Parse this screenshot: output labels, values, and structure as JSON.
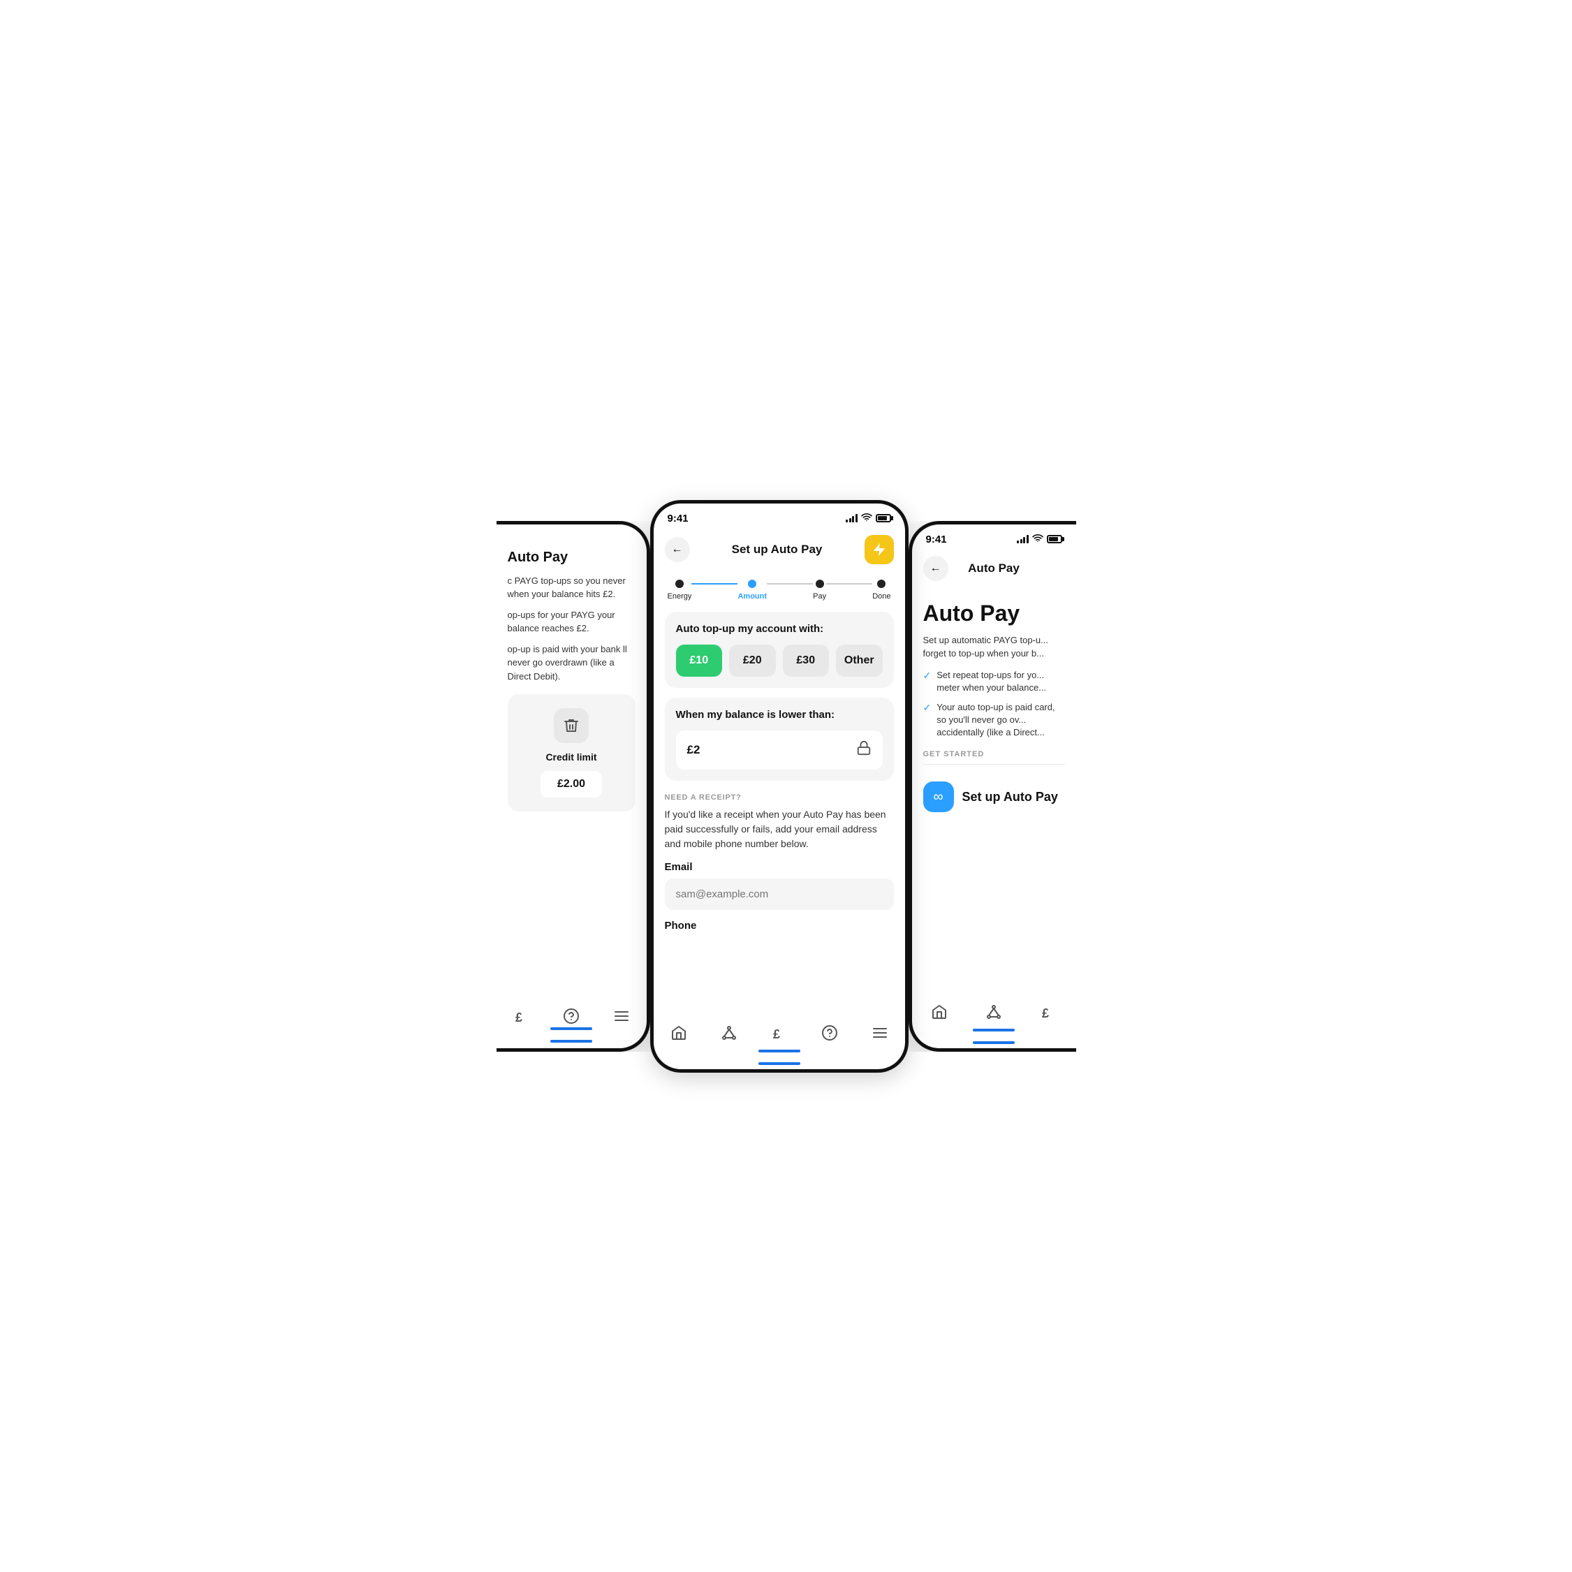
{
  "phones": {
    "left": {
      "statusBar": {
        "hasTime": false
      },
      "title": "Auto Pay",
      "description1": "c PAYG top-ups so you never when your balance hits £2.",
      "description2": "op-ups for your PAYG your balance reaches £2.",
      "description3": "op-up is paid with your bank ll never go overdrawn (like a Direct Debit).",
      "card": {
        "trashIcon": "🗑",
        "creditLabel": "Credit limit",
        "creditAmount": "£2.00"
      },
      "bottomNav": {
        "icons": [
          "pound",
          "help",
          "menu"
        ]
      }
    },
    "center": {
      "statusBar": {
        "time": "9:41"
      },
      "navTitle": "Set up Auto Pay",
      "lightningIcon": "⚡",
      "steps": [
        {
          "label": "Energy",
          "state": "done"
        },
        {
          "label": "Amount",
          "state": "active"
        },
        {
          "label": "Pay",
          "state": "inactive"
        },
        {
          "label": "Done",
          "state": "inactive"
        }
      ],
      "autoTopUp": {
        "title": "Auto top-up my account with:",
        "options": [
          {
            "label": "£10",
            "selected": true
          },
          {
            "label": "£20",
            "selected": false
          },
          {
            "label": "£30",
            "selected": false
          },
          {
            "label": "Other",
            "selected": false
          }
        ]
      },
      "balance": {
        "title": "When my balance is lower than:",
        "value": "£2",
        "lockIcon": "🔒"
      },
      "receipt": {
        "sectionLabel": "NEED A RECEIPT?",
        "description": "If you'd like a receipt when your Auto Pay has been paid successfully or fails, add your email address and mobile phone number below.",
        "emailLabel": "Email",
        "emailPlaceholder": "sam@example.com",
        "phoneLabel": "Phone"
      },
      "bottomNav": {
        "icons": [
          "home",
          "network",
          "pound",
          "help",
          "menu"
        ]
      }
    },
    "right": {
      "statusBar": {
        "time": "9:41"
      },
      "backLabel": "←",
      "navTitle": "Auto Pay",
      "bigTitle": "Auto Pay",
      "description": "Set up automatic PAYG top-u... forget to top-up when your b...",
      "checkItems": [
        "Set repeat top-ups for yo... meter when your balance...",
        "Your auto top-up is paid card, so you'll never go ov... accidentally (like a Direct..."
      ],
      "getStartedLabel": "GET STARTED",
      "setupBtn": {
        "icon": "∞",
        "label": "Set up Auto Pay"
      },
      "bottomNav": {
        "icons": [
          "home",
          "network",
          "pound"
        ]
      }
    }
  }
}
